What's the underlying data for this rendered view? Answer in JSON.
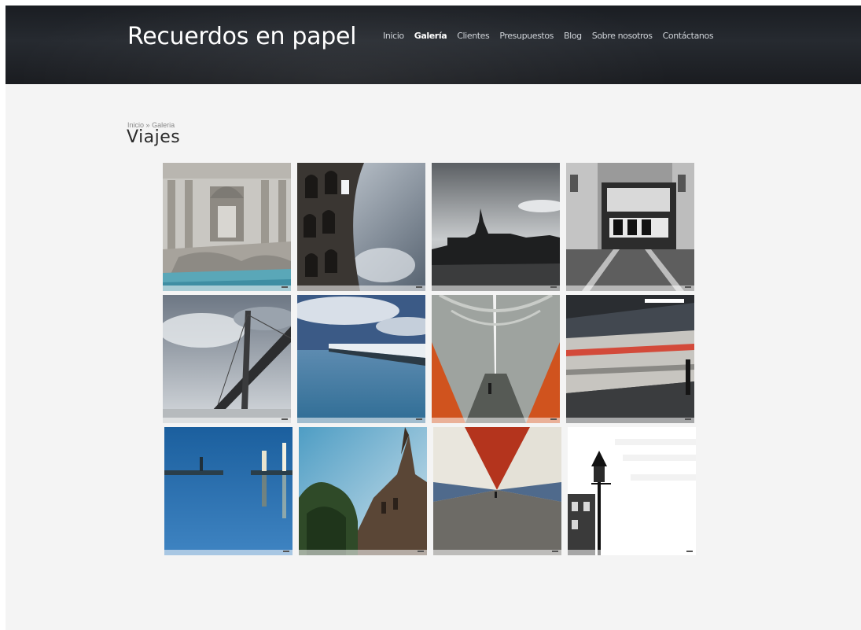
{
  "site": {
    "title": "Recuerdos en papel"
  },
  "nav": [
    {
      "label": "Inicio",
      "active": false
    },
    {
      "label": "Galería",
      "active": true
    },
    {
      "label": "Clientes",
      "active": false
    },
    {
      "label": "Presupuestos",
      "active": false
    },
    {
      "label": "Blog",
      "active": false
    },
    {
      "label": "Sobre nosotros",
      "active": false
    },
    {
      "label": "Contáctanos",
      "active": false
    }
  ],
  "breadcrumb": {
    "home": "Inicio",
    "separator": "»",
    "current": "Galeria"
  },
  "page_title": "Viajes",
  "gallery": [
    {
      "subject": "fountain-baroque-facade"
    },
    {
      "subject": "colosseum-arches"
    },
    {
      "subject": "palace-silhouette-square"
    },
    {
      "subject": "tram-on-tracks"
    },
    {
      "subject": "cable-stayed-bridge"
    },
    {
      "subject": "pier-over-sea"
    },
    {
      "subject": "metro-tunnel-orange"
    },
    {
      "subject": "train-motion-blur"
    },
    {
      "subject": "harbor-lights-blue"
    },
    {
      "subject": "gothic-tower-trees"
    },
    {
      "subject": "walkway-tunnel-red"
    },
    {
      "subject": "street-lamp-facades"
    }
  ],
  "colors": {
    "header_bg": "#1f2226",
    "page_bg": "#f4f4f4",
    "nav_text": "#cfd3d8",
    "title_text": "#2a2a2a"
  }
}
